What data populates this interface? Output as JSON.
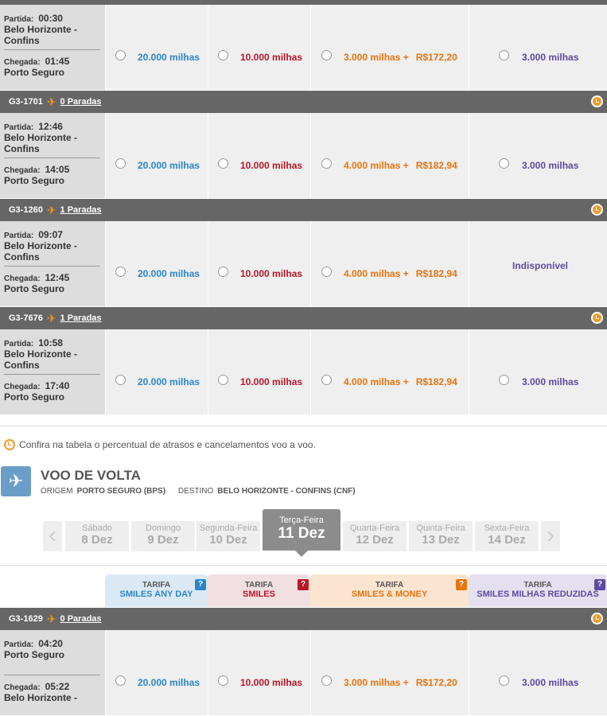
{
  "outbound": {
    "rows": [
      {
        "head": null,
        "dep_label": "Partida:",
        "dep_time": "00:30",
        "dep_city": "Belo Horizonte - Confins",
        "arr_label": "Chegada:",
        "arr_time": "01:45",
        "arr_city": "Porto Seguro",
        "any_day": "20.000 milhas",
        "smiles": "10.000 milhas",
        "money_miles": "3.000 milhas +",
        "money_cash": "R$172,20",
        "reduced": "3.000 milhas"
      },
      {
        "head": {
          "code": "G3-1701",
          "stops": "0 Paradas"
        },
        "dep_label": "Partida:",
        "dep_time": "12:46",
        "dep_city": "Belo Horizonte - Confins",
        "arr_label": "Chegada:",
        "arr_time": "14:05",
        "arr_city": "Porto Seguro",
        "any_day": "20.000 milhas",
        "smiles": "10.000 milhas",
        "money_miles": "4.000 milhas +",
        "money_cash": "R$182,94",
        "reduced": "3.000 milhas"
      },
      {
        "head": {
          "code": "G3-1260",
          "stops": "1 Paradas"
        },
        "dep_label": "Partida:",
        "dep_time": "09:07",
        "dep_city": "Belo Horizonte - Confins",
        "arr_label": "Chegada:",
        "arr_time": "12:45",
        "arr_city": "Porto Seguro",
        "any_day": "20.000 milhas",
        "smiles": "10.000 milhas",
        "money_miles": "4.000 milhas +",
        "money_cash": "R$182,94",
        "reduced": "Indisponível"
      },
      {
        "head": {
          "code": "G3-7676",
          "stops": "1 Paradas"
        },
        "dep_label": "Partida:",
        "dep_time": "10:58",
        "dep_city": "Belo Horizonte - Confins",
        "arr_label": "Chegada:",
        "arr_time": "17:40",
        "arr_city": "Porto Seguro",
        "any_day": "20.000 milhas",
        "smiles": "10.000 milhas",
        "money_miles": "4.000 milhas +",
        "money_cash": "R$182,94",
        "reduced": "3.000 milhas"
      }
    ]
  },
  "note": "Confira na tabela o percentual de atrasos e cancelamentos voo a voo.",
  "volta": {
    "title": "VOO DE VOLTA",
    "origin_label": "ORIGEM",
    "origin": "PORTO SEGURO (BPS)",
    "dest_label": "DESTINO",
    "dest": "BELO HORIZONTE - CONFINS (CNF)"
  },
  "dates": [
    {
      "name": "Sábado",
      "date": "8 Dez"
    },
    {
      "name": "Domingo",
      "date": "9 Dez"
    },
    {
      "name": "Segunda-Feira",
      "date": "10 Dez"
    },
    {
      "name": "Terça-Feira",
      "date": "11 Dez"
    },
    {
      "name": "Quarta-Feira",
      "date": "12 Dez"
    },
    {
      "name": "Quinta-Feira",
      "date": "13 Dez"
    },
    {
      "name": "Sexta-Feira",
      "date": "14 Dez"
    }
  ],
  "tariffs": [
    {
      "label": "TARIFA",
      "name": "SMILES ANY DAY",
      "help": "?"
    },
    {
      "label": "TARIFA",
      "name": "SMILES",
      "help": "?"
    },
    {
      "label": "TARIFA",
      "name": "SMILES & MONEY",
      "help": "?"
    },
    {
      "label": "TARIFA",
      "name": "SMILES MILHAS REDUZIDAS",
      "help": "?"
    }
  ],
  "return_flight": {
    "head": {
      "code": "G3-1629",
      "stops": "0 Paradas"
    },
    "dep_label": "Partida:",
    "dep_time": "04:20",
    "dep_city": "Porto Seguro",
    "arr_label": "Chegada:",
    "arr_time": "05:22",
    "arr_city": "Belo Horizonte -",
    "any_day": "20.000 milhas",
    "smiles": "10.000 milhas",
    "money_miles": "3.000 milhas +",
    "money_cash": "R$172,20",
    "reduced": "3.000 milhas"
  },
  "icons": {
    "plane": "plane-icon",
    "clock": "clock-icon"
  }
}
